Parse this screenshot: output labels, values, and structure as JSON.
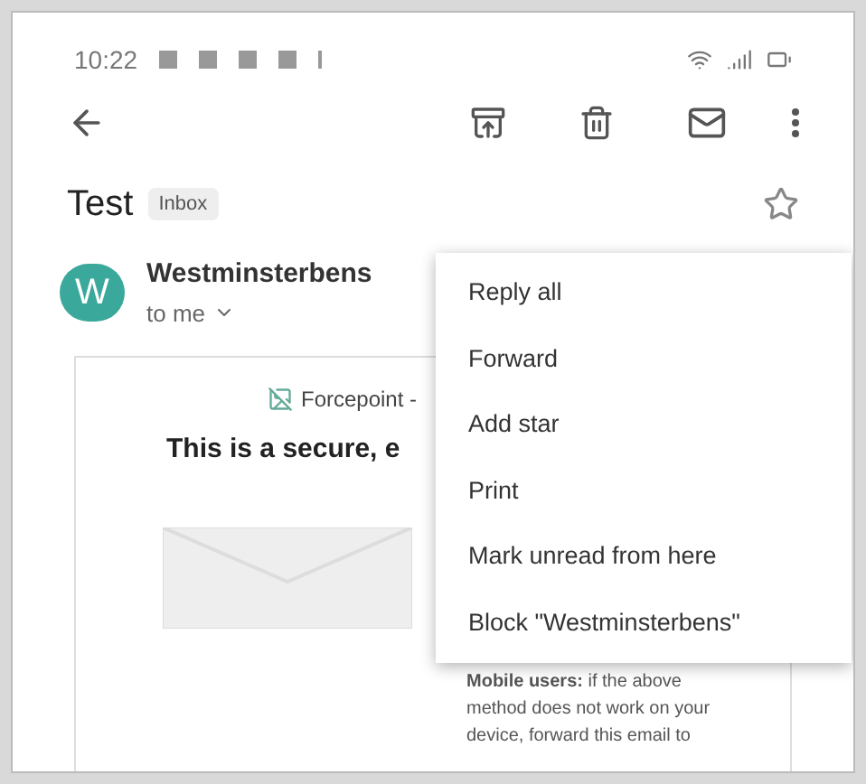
{
  "status_bar": {
    "time": "10:22"
  },
  "subject": {
    "title": "Test",
    "label": "Inbox",
    "starred": false
  },
  "message": {
    "avatar": "W",
    "sender": "Westminsterbens",
    "recipient": "to me",
    "logo_alt": "Forcepoint -",
    "heading": "This is a secure, e",
    "note": "**Mobile users:** if the above method does not work on your device, forward this email to"
  },
  "menu": [
    "Reply all",
    "Forward",
    "Add star",
    "Print",
    "Mark unread from here",
    "Block \"Westminsterbens\""
  ]
}
